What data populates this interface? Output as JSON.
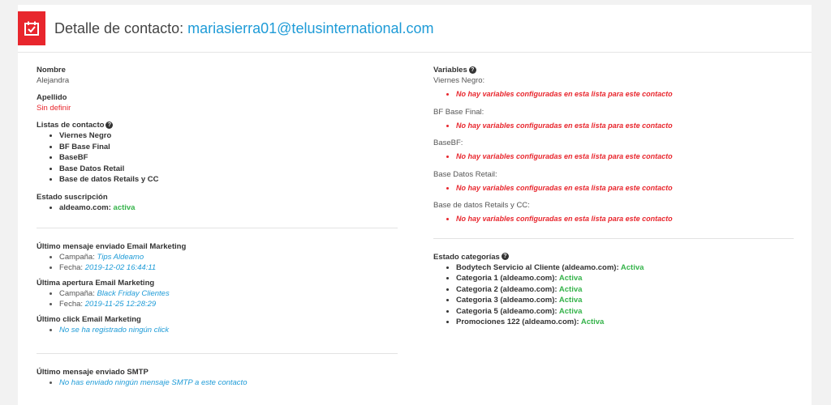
{
  "header": {
    "title": "Detalle de contacto:",
    "email": "mariasierra01@telusinternational.com"
  },
  "left": {
    "nombre_label": "Nombre",
    "nombre_value": "Alejandra",
    "apellido_label": "Apellido",
    "apellido_value": "Sin definir",
    "listas_label": "Listas de contacto",
    "listas": [
      "Viernes Negro",
      "BF Base Final",
      "BaseBF",
      "Base Datos Retail",
      "Base de datos Retails y CC"
    ],
    "estado_label": "Estado suscripción",
    "estado_domain": "aldeamo.com:",
    "estado_status": "activa",
    "ultimo_mensaje_label": "Último mensaje enviado Email Marketing",
    "campana_label": "Campaña:",
    "fecha_label": "Fecha:",
    "ultimo_mensaje_campana": "Tips Aldeamo",
    "ultimo_mensaje_fecha": "2019-12-02 16:44:11",
    "ultima_apertura_label": "Última apertura Email Marketing",
    "ultima_apertura_campana": "Black Friday Clientes",
    "ultima_apertura_fecha": "2019-11-25 12:28:29",
    "ultimo_click_label": "Último click Email Marketing",
    "ultimo_click_value": "No se ha registrado ningún click",
    "ultimo_smtp_label": "Último mensaje enviado SMTP",
    "ultimo_smtp_value": "No has enviado ningún mensaje SMTP a este contacto"
  },
  "right": {
    "variables_label": "Variables",
    "no_vars_text": "No hay variables configuradas en esta lista para este contacto",
    "variables": [
      "Viernes Negro:",
      "BF Base Final:",
      "BaseBF:",
      "Base Datos Retail:",
      "Base de datos Retails y CC:"
    ],
    "categorias_label": "Estado categorías",
    "categorias": [
      {
        "name": "Bodytech Servicio al Cliente (aldeamo.com):",
        "status": "Activa"
      },
      {
        "name": "Categoria 1 (aldeamo.com):",
        "status": "Activa"
      },
      {
        "name": "Categoria 2 (aldeamo.com):",
        "status": "Activa"
      },
      {
        "name": "Categoria 3 (aldeamo.com):",
        "status": "Activa"
      },
      {
        "name": "Categoria 5 (aldeamo.com):",
        "status": "Activa"
      },
      {
        "name": "Promociones 122 (aldeamo.com):",
        "status": "Activa"
      }
    ]
  },
  "colors": {
    "accent": "#e8262d",
    "link": "#1e9bd7",
    "active": "#35b34a"
  }
}
